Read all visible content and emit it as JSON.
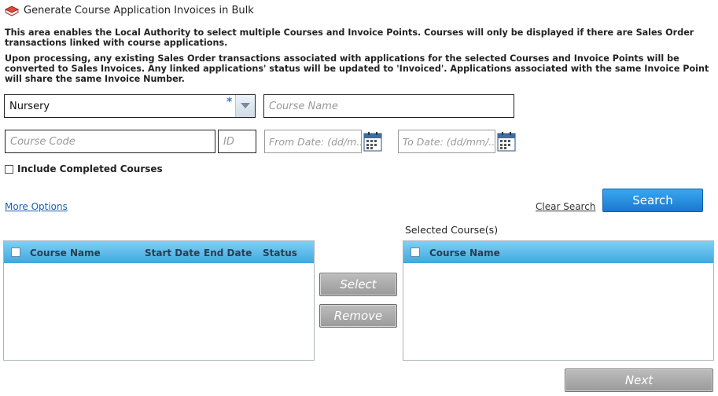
{
  "header": {
    "title": "Generate Course Application Invoices in Bulk",
    "icon": "book-icon"
  },
  "description": {
    "line1": "This area enables the Local Authority to select multiple Courses and Invoice Points. Courses will only be displayed if there are Sales Order transactions linked with course applications.",
    "line2": "Upon processing, any existing Sales Order transactions associated with applications for the selected Courses and Invoice Points will be converted to Sales Invoices. Any linked applications' status will be updated to 'Invoiced'.  Applications associated with the same Invoice Point will share the same Invoice Number."
  },
  "filters": {
    "course_type": {
      "value": "Nursery",
      "required_marker": "*"
    },
    "course_name": {
      "placeholder": "Course Name",
      "value": ""
    },
    "course_code": {
      "placeholder": "Course Code",
      "value": ""
    },
    "id": {
      "placeholder": "ID",
      "value": ""
    },
    "from_date": {
      "placeholder": "From Date: (dd/m...",
      "value": ""
    },
    "to_date": {
      "placeholder": "To Date: (dd/mm/...",
      "value": ""
    },
    "include_completed": {
      "label": "Include Completed Courses",
      "checked": false
    }
  },
  "actions": {
    "more_options": "More Options",
    "clear_search": "Clear Search",
    "search": "Search",
    "select": "Select",
    "remove": "Remove",
    "next": "Next"
  },
  "courses_table": {
    "columns": [
      "Course Name",
      "Start Date",
      "End Date",
      "Status"
    ],
    "rows": []
  },
  "selected_courses": {
    "label": "Selected Course(s)",
    "columns": [
      "Course Name"
    ],
    "rows": []
  },
  "colors": {
    "accent_blue": "#1a78cf",
    "header_blue": "#3fa8e0",
    "disabled_gray": "#a8a8a8"
  }
}
